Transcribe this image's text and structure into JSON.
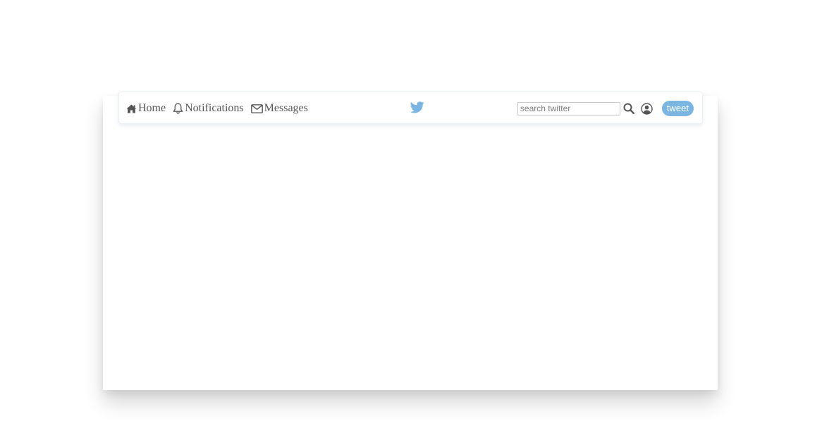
{
  "nav": {
    "home_label": "Home",
    "notifications_label": "Notifications",
    "messages_label": "Messages"
  },
  "search": {
    "placeholder": "search twitter"
  },
  "actions": {
    "tweet_label": "tweet"
  },
  "icons": {
    "home": "home-icon",
    "notifications": "bell-icon",
    "messages": "envelope-icon",
    "logo": "twitter-bird-icon",
    "search": "search-icon",
    "profile": "user-circle-icon"
  },
  "colors": {
    "brand": "#7bb6e3",
    "text": "#555555"
  }
}
